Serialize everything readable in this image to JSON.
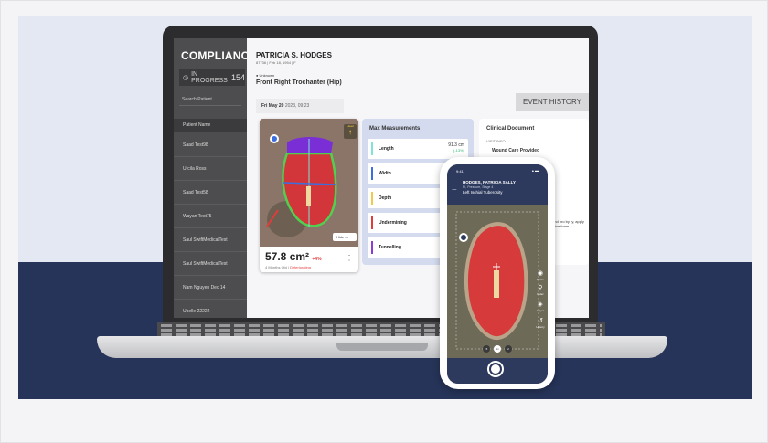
{
  "sidebar": {
    "title": "COMPLIANCE",
    "progress_label": "IN PROGRESS",
    "progress_count": "154",
    "search_placeholder": "Search Patient",
    "list_header": "Patient Name",
    "patients": [
      "Saad Test98",
      "Urcila Ross",
      "Saad Test58",
      "Wayan Test75",
      "Saul SwiftMedicalTest",
      "Saul SwiftMedicalTest",
      "Nam Nguyen Dec 14",
      "Ubelle 22222"
    ]
  },
  "patient": {
    "name": "PATRICIA S. HODGES",
    "meta": "87736 | Feb 18, 1954 | F",
    "status": "Unknown",
    "location": "Front Right Trochanter (Hip)"
  },
  "assessment": {
    "date": "Fri May 20",
    "year_time": "2023, 09:23",
    "event_history": "EVENT HISTORY"
  },
  "wound": {
    "area": "57.8 cm²",
    "delta": "+4%",
    "age_text": "4 Months Old |",
    "trend": "Deteriorating",
    "hide_label": "Hide",
    "head_label": "Head"
  },
  "measurements": {
    "title": "Max Measurements",
    "rows": [
      {
        "label": "Length",
        "value": "91.3 cm",
        "sub": "(-13%)",
        "color": "#7fe3d9"
      },
      {
        "label": "Width",
        "value": "",
        "sub": "",
        "color": "#3b6fe0"
      },
      {
        "label": "Depth",
        "value": "",
        "sub": "",
        "color": "#f2c94c"
      },
      {
        "label": "Undermining",
        "value": "",
        "sub": "",
        "color": "#e23b3b"
      },
      {
        "label": "Tunnelling",
        "value": "",
        "sub": "",
        "color": "#8e3bd6"
      }
    ]
  },
  "clinical": {
    "title": "Clinical Document",
    "visit_info": "VISIT INFO",
    "care_provided": "Wound Care Provided",
    "text": "and pro by ry, apply ctive foam"
  },
  "phone": {
    "time": "9:41",
    "patient_name": "HODGES, PATRICIA SALLY",
    "info": "PI, Pressure, Stage 4",
    "location": "Left Ischial Tuberosity",
    "zoom_options": [
      ".5",
      "1x",
      "2"
    ],
    "tools": [
      "Photo",
      "Ruler",
      "Layer",
      "History"
    ]
  },
  "colors": {
    "navy": "#263459",
    "light_blue": "#e3e8f2",
    "sidebar": "#4d4d4f"
  }
}
